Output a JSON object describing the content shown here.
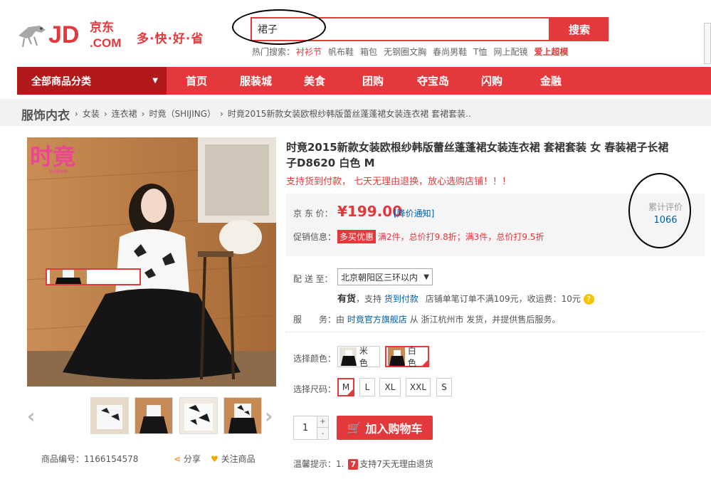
{
  "header": {
    "logo_text": "JD",
    "logo_sub": "京东",
    "logo_com": ".COM",
    "slogan": "多·快·好·省",
    "search": {
      "value": "裙子",
      "button": "搜索"
    },
    "hot_label": "热门搜索：",
    "hot_links": [
      "衬衫节",
      "帆布鞋",
      "箱包",
      "无钢圈文胸",
      "春尚男鞋",
      "T恤",
      "网上配镜",
      "爱上超模"
    ]
  },
  "nav": {
    "all_categories": "全部商品分类",
    "items": [
      "首页",
      "服装城",
      "美食",
      "团购",
      "夺宝岛",
      "闪购",
      "金融"
    ]
  },
  "breadcrumb": {
    "root": "服饰内衣",
    "items": [
      "女装",
      "连衣裙",
      "时竟（SHIJING）",
      "时竟2015新款女装欧根纱韩版蕾丝蓬蓬裙女装连衣裙 套裙套装.."
    ]
  },
  "gallery": {
    "brand_mark": "时竟",
    "brand_sub": "SHIJING",
    "item_no_label": "商品编号：",
    "item_no": "1166154578",
    "share": "分享",
    "follow": "关注商品"
  },
  "product": {
    "title": "时竟2015新款女装欧根纱韩版蕾丝蓬蓬裙女装连衣裙 套裙套装 女 春装裙子长裙子D8620 白色 M",
    "promo": "支持货到付款， 七天无理由退换，放心选购店铺！！！",
    "price_label": "京 东 价：",
    "price": "¥199.00",
    "price_notice": "[降价通知]",
    "promo_label": "促销信息：",
    "promo_tag": "多买优惠",
    "promo_text": "满2件，总价打9.8折；满3件，总价打9.5折",
    "reviews_label": "累计评价",
    "reviews_count": "1066",
    "delivery_label": "配 送 至：",
    "delivery_value": "北京朝阳区三环以内",
    "stock_status": "有货",
    "stock_mid": "，支持",
    "stock_link": "货到付款",
    "stock_rest": "店铺单笔订单不满109元，收运费：10元",
    "service_label": "服　　务：",
    "service_pre": "由",
    "service_link": "时竟官方旗舰店",
    "service_rest": "从 浙江杭州市 发货，并提供售后服务。",
    "color_label": "选择颜色：",
    "colors": [
      "米色",
      "白色"
    ],
    "selected_color": "白色",
    "size_label": "选择尺码：",
    "sizes": [
      "M",
      "L",
      "XL",
      "XXL",
      "S"
    ],
    "selected_size": "M",
    "quantity": "1",
    "qty_plus": "+",
    "qty_minus": "-",
    "add_to_cart": "加入购物车",
    "tip_label": "温馨提示：",
    "tip_num": "1.",
    "tip_badge": "7",
    "tip_text": "支持7天无理由退货"
  },
  "colors": {
    "accent": "#e4393c",
    "link": "#005ea7",
    "nav_dark": "#b1191a"
  }
}
